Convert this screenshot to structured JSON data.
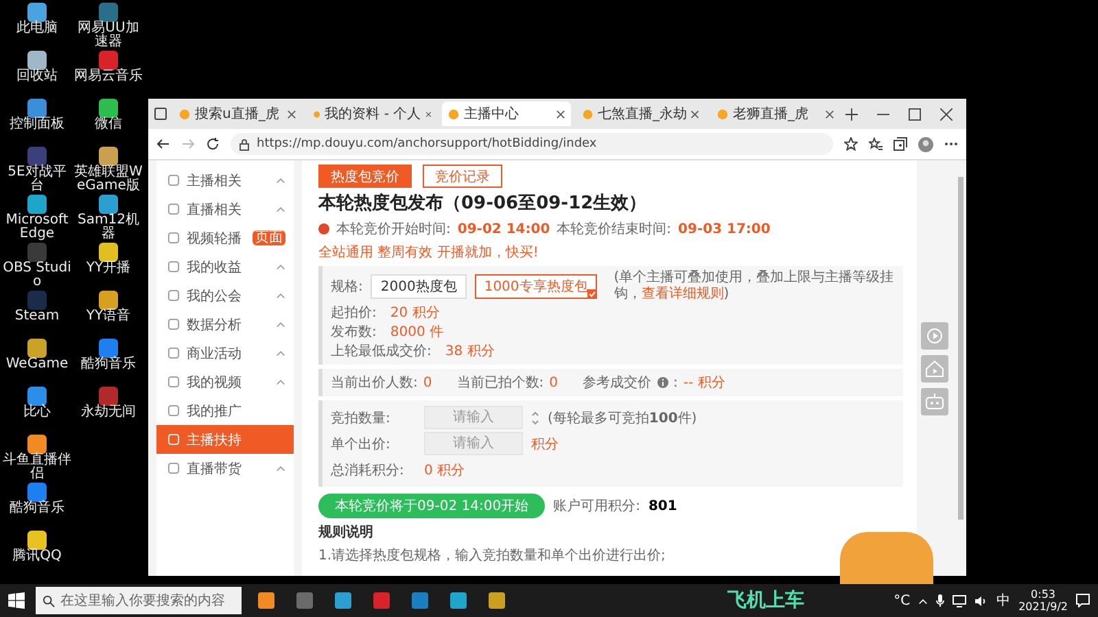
{
  "desktop": {
    "columns": [
      [
        {
          "label": "此电脑",
          "color": "#4aa3df"
        },
        {
          "label": "回收站",
          "color": "#9fb7c9"
        },
        {
          "label": "控制面板",
          "color": "#3a8fd8"
        },
        {
          "label": "5E对战平台",
          "color": "#3b3f7a"
        },
        {
          "label": "Microsoft Edge",
          "color": "#1fa5c9"
        },
        {
          "label": "OBS Studio",
          "color": "#3a3a3a"
        },
        {
          "label": "Steam",
          "color": "#1b2b4a"
        },
        {
          "label": "WeGame",
          "color": "#c9a227"
        },
        {
          "label": "比心",
          "color": "#2b8ee8"
        },
        {
          "label": "斗鱼直播伴侣",
          "color": "#f08a24"
        },
        {
          "label": "酷狗音乐",
          "color": "#1e7ff0"
        },
        {
          "label": "腾讯QQ",
          "color": "#e8c21e"
        }
      ],
      [
        {
          "label": "网易UU加速器",
          "color": "#2a6f8a"
        },
        {
          "label": "网易云音乐",
          "color": "#d8232a"
        },
        {
          "label": "微信",
          "color": "#2dbd4e"
        },
        {
          "label": "英雄联盟WeGame版",
          "color": "#c9a050"
        },
        {
          "label": "Sam12机器",
          "color": "#2a9fd0"
        },
        {
          "label": "YY开播",
          "color": "#e0c020"
        },
        {
          "label": "YY语音",
          "color": "#d8a020"
        },
        {
          "label": "酷狗音乐",
          "color": "#1e7ff0"
        },
        {
          "label": "永劫无间",
          "color": "#b02a2a"
        }
      ]
    ]
  },
  "browser": {
    "tabs": [
      {
        "title": "搜索u直播_虎",
        "selected": false
      },
      {
        "title": "我的资料 - 个人",
        "selected": false
      },
      {
        "title": "主播中心",
        "selected": true
      },
      {
        "title": "七煞直播_永劫",
        "selected": false
      },
      {
        "title": "老狮直播_虎",
        "selected": false
      }
    ],
    "url": "https://mp.douyu.com/anchorsupport/hotBidding/index"
  },
  "sidebar": [
    {
      "label": "主播相关",
      "expandable": true,
      "selected": false
    },
    {
      "label": "直播相关",
      "expandable": true,
      "selected": false
    },
    {
      "label": "视频轮播",
      "expandable": false,
      "selected": false,
      "badge": "页面"
    },
    {
      "label": "我的收益",
      "expandable": true,
      "selected": false
    },
    {
      "label": "我的公会",
      "expandable": true,
      "selected": false
    },
    {
      "label": "数据分析",
      "expandable": true,
      "selected": false
    },
    {
      "label": "商业活动",
      "expandable": true,
      "selected": false
    },
    {
      "label": "我的视频",
      "expandable": true,
      "selected": false
    },
    {
      "label": "我的推广",
      "expandable": false,
      "selected": false
    },
    {
      "label": "主播扶持",
      "expandable": false,
      "selected": true
    },
    {
      "label": "直播带货",
      "expandable": true,
      "selected": false
    }
  ],
  "page": {
    "tabs": [
      {
        "label": "热度包竞价",
        "selected": true
      },
      {
        "label": "竞价记录",
        "selected": false
      }
    ],
    "title": "本轮热度包发布（09-06至09-12生效）",
    "times": [
      {
        "label": "本轮竞价开始时间:",
        "value": "09-02 14:00"
      },
      {
        "label": "本轮竞价结束时间:",
        "value": "09-03 17:00"
      }
    ],
    "promo": "全站通用 整周有效 开播就加，快买!",
    "spec_label": "规格:",
    "specs": [
      {
        "label": "2000热度包",
        "selected": false
      },
      {
        "label": "1000专享热度包",
        "selected": true
      }
    ],
    "spec_note": "(单个主播可叠加使用，叠加上限与主播等级挂钩，",
    "spec_link": "查看详细规则",
    "spec_note_end": ")",
    "details": [
      {
        "label": "起拍价:",
        "value": "20 积分"
      },
      {
        "label": "发布数:",
        "value": "8000 件"
      },
      {
        "label": "上轮最低成交价:",
        "value": "38 积分"
      }
    ],
    "stats": [
      {
        "label": "当前出价人数:",
        "value": "0"
      },
      {
        "label": "当前已拍个数:",
        "value": "0"
      },
      {
        "label": "参考成交价",
        "value": "-- 积分"
      }
    ],
    "stats_colon": ":",
    "inputs": [
      {
        "label": "竞拍数量:",
        "placeholder": "请输入",
        "kind": "spinner",
        "hint": "(每轮最多可竞拍**100**件)"
      },
      {
        "label": "单个出价:",
        "placeholder": "请输入",
        "kind": "unit",
        "hint": "积分"
      }
    ],
    "total_label": "总消耗积分:",
    "total_value": "0 积分",
    "start_button": "本轮竞价将于09-02 14:00开始",
    "balance_label": "账户可用积分:",
    "balance_value": "801",
    "rules_title": "规则说明",
    "rules": [
      "1.请选择热度包规格，输入竞拍数量和单个出价进行出价;"
    ]
  },
  "taskbar": {
    "search_placeholder": "在这里输入你要搜索的内容",
    "apps": [
      {
        "color": "#f08a24"
      },
      {
        "color": "#6a6a6a"
      },
      {
        "color": "#2a9fd0"
      },
      {
        "color": "#d8232a"
      },
      {
        "color": "#1a7fc0"
      },
      {
        "color": "#1fa5c9"
      },
      {
        "color": "#c9a020"
      }
    ],
    "overlay_text": "飞机上车",
    "temperature": "°C",
    "ime": "中",
    "time": "0:53",
    "date": "2021/9/2"
  }
}
